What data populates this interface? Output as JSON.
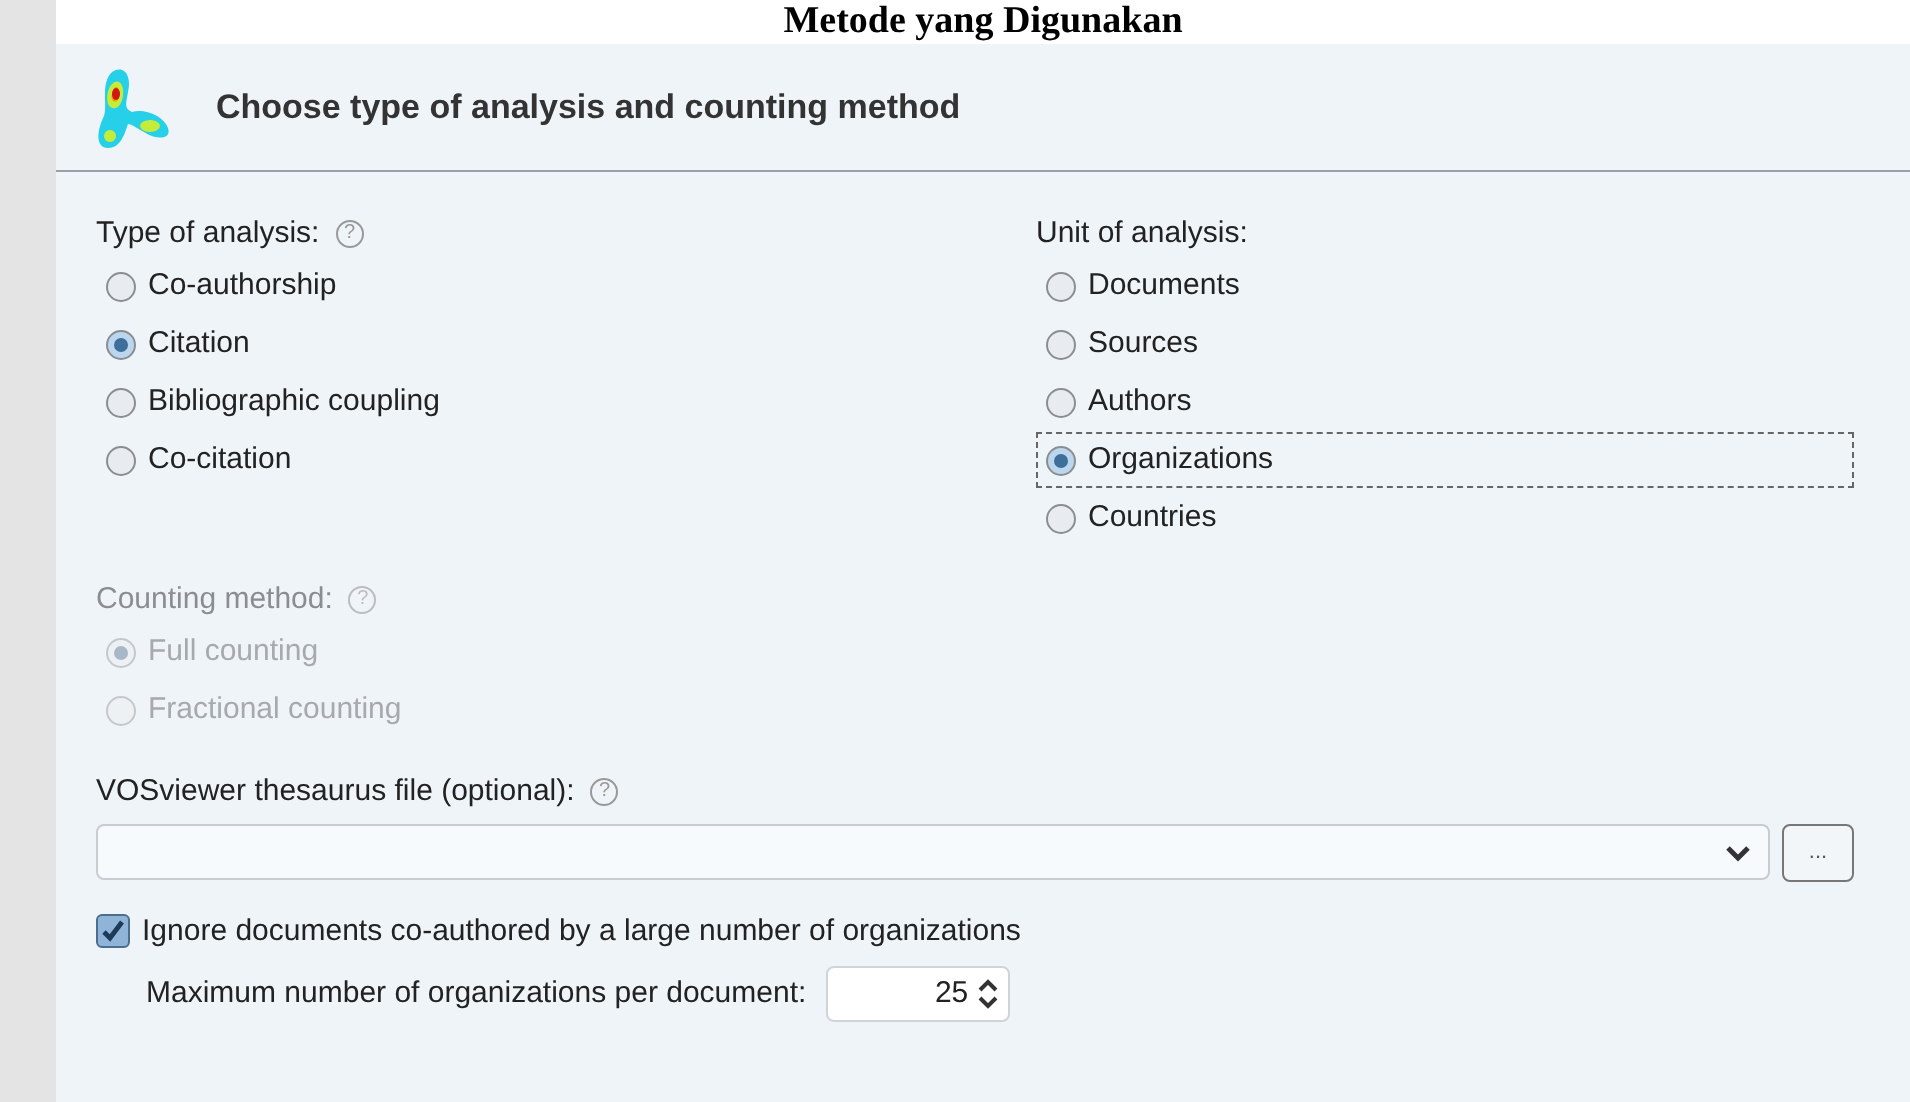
{
  "document_heading": "Metode yang Digunakan",
  "dialog": {
    "title": "Choose type of analysis and counting method"
  },
  "type_of_analysis": {
    "label": "Type of analysis:",
    "help": "?",
    "options": [
      {
        "label": "Co-authorship",
        "selected": false
      },
      {
        "label": "Citation",
        "selected": true
      },
      {
        "label": "Bibliographic coupling",
        "selected": false
      },
      {
        "label": "Co-citation",
        "selected": false
      }
    ]
  },
  "unit_of_analysis": {
    "label": "Unit of analysis:",
    "options": [
      {
        "label": "Documents",
        "selected": false,
        "focused": false
      },
      {
        "label": "Sources",
        "selected": false,
        "focused": false
      },
      {
        "label": "Authors",
        "selected": false,
        "focused": false
      },
      {
        "label": "Organizations",
        "selected": true,
        "focused": true
      },
      {
        "label": "Countries",
        "selected": false,
        "focused": false
      }
    ]
  },
  "counting_method": {
    "label": "Counting method:",
    "help": "?",
    "disabled": true,
    "options": [
      {
        "label": "Full counting",
        "selected": true
      },
      {
        "label": "Fractional counting",
        "selected": false
      }
    ]
  },
  "thesaurus": {
    "label": "VOSviewer thesaurus file (optional):",
    "help": "?",
    "browse_button": "..."
  },
  "ignore_documents": {
    "label": "Ignore documents co-authored by a large number of organizations",
    "checked": true
  },
  "max_per_document": {
    "label": "Maximum number of organizations per document:",
    "value": "25"
  }
}
